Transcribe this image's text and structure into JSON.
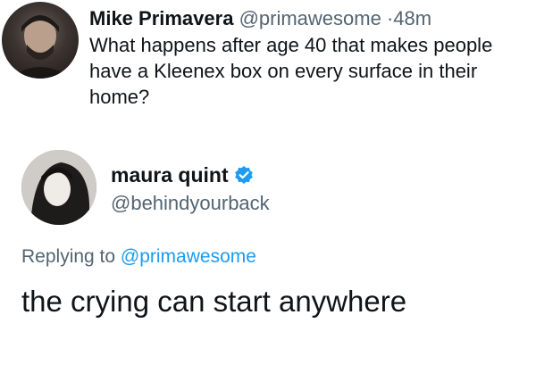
{
  "original_tweet": {
    "author_name": "Mike Primavera",
    "author_handle": "@primawesome",
    "separator": "·",
    "time": "48m",
    "text": "What happens after age 40 that makes people have a Kleenex box on every surface in their home?"
  },
  "reply": {
    "author_name": "maura quint",
    "author_handle": "@behindyourback",
    "verified_icon": "verified-badge-icon",
    "replying_prefix": "Replying to",
    "replying_to": "@primawesome",
    "text": "the crying can start anywhere"
  },
  "colors": {
    "text": "#0f1419",
    "muted": "#536471",
    "link": "#1d9bf0",
    "verified": "#1d9bf0"
  }
}
